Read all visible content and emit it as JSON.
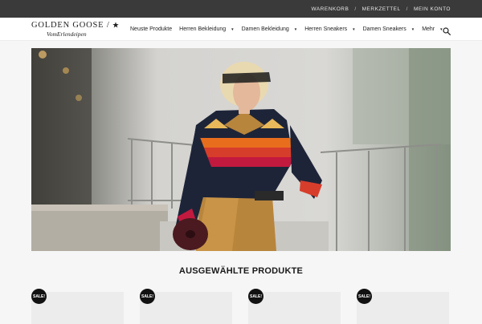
{
  "topbar": {
    "links": [
      "WARENKORB",
      "MERKZETTEL",
      "MEIN KONTO"
    ],
    "separator": "/"
  },
  "brand": {
    "name": "GOLDEN GOOSE",
    "slash": "/",
    "tagline": "VomErlendeipen"
  },
  "nav": {
    "items": [
      {
        "label": "Neuste Produkte",
        "dropdown": false
      },
      {
        "label": "Herren Bekleidung",
        "dropdown": true
      },
      {
        "label": "Damen Bekleidung",
        "dropdown": true
      },
      {
        "label": "Herren Sneakers",
        "dropdown": true
      },
      {
        "label": "Damen Sneakers",
        "dropdown": true
      },
      {
        "label": "Mehr",
        "dropdown": true
      }
    ],
    "caret": "▼"
  },
  "section": {
    "title": "AUSGEWÄHLTE PRODUKTE"
  },
  "products": [
    {
      "badge": "SALE!"
    },
    {
      "badge": "SALE!"
    },
    {
      "badge": "SALE!"
    },
    {
      "badge": "SALE!"
    }
  ],
  "colors": {
    "topbar": "#3a3a3a",
    "header": "#ffffff",
    "background": "#f6f6f6",
    "badge": "#111111"
  },
  "icons": {
    "search": "search-icon",
    "star": "star-icon"
  }
}
